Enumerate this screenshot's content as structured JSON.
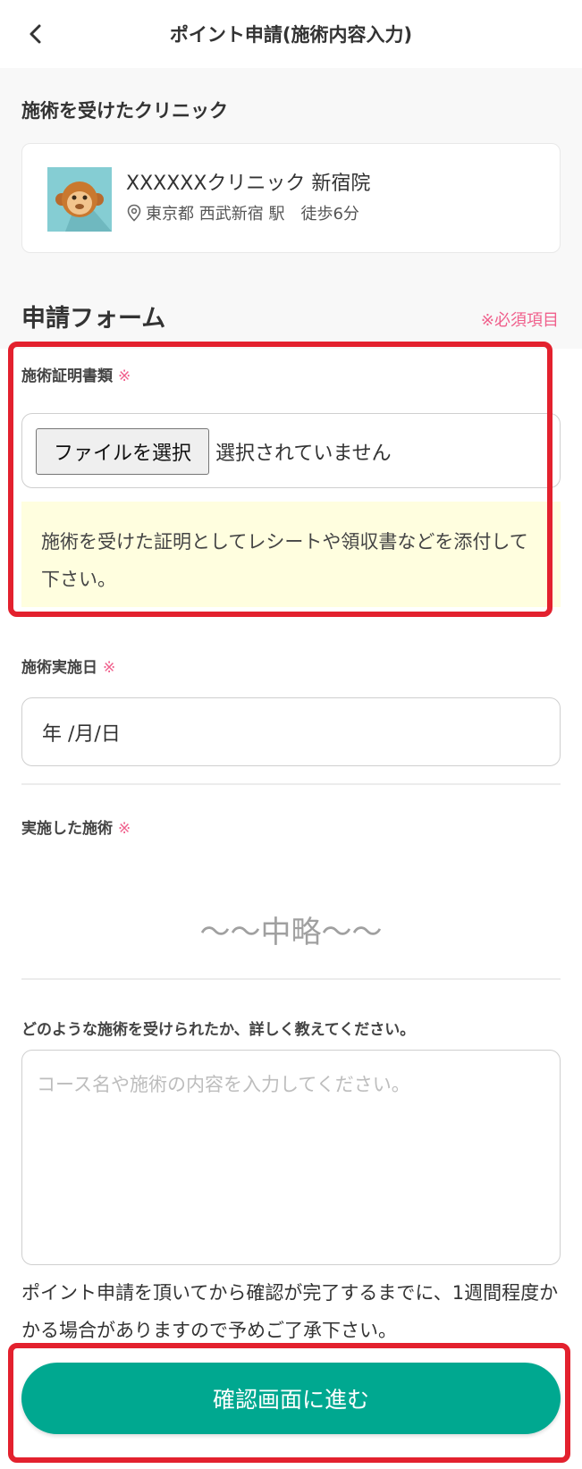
{
  "header": {
    "title": "ポイント申請(施術内容入力)"
  },
  "clinic": {
    "section_label": "施術を受けたクリニック",
    "name": "XXXXXXクリニック 新宿院",
    "location": "東京都 西武新宿 駅　徒歩6分"
  },
  "form": {
    "title": "申請フォーム",
    "required_note": "※必須項目",
    "required_mark": "※",
    "proof": {
      "label": "施術証明書類",
      "file_button": "ファイルを選択",
      "file_status": "選択されていません",
      "hint": "施術を受けた証明としてレシートや領収書などを添付して下さい。"
    },
    "date": {
      "label": "施術実施日",
      "value": "年 /月/日"
    },
    "treatment": {
      "label": "実施した施術"
    },
    "omitted_text": "〜〜中略〜〜",
    "detail": {
      "label": "どのような施術を受けられたか、詳しく教えてください。",
      "placeholder": "コース名や施術の内容を入力してください。"
    },
    "notice": "ポイント申請を頂いてから確認が完了するまでに、1週間程度かかる場合がありますので予めご了承下さい。",
    "submit_label": "確認画面に進む"
  },
  "colors": {
    "accent": "#00a890",
    "required": "#f0608c",
    "highlight": "#e3212e",
    "hint_bg": "#fffedf"
  },
  "icons": {
    "back": "chevron-left-icon",
    "location": "location-pin-icon",
    "clinic_thumbnail": "monkey-avatar"
  }
}
